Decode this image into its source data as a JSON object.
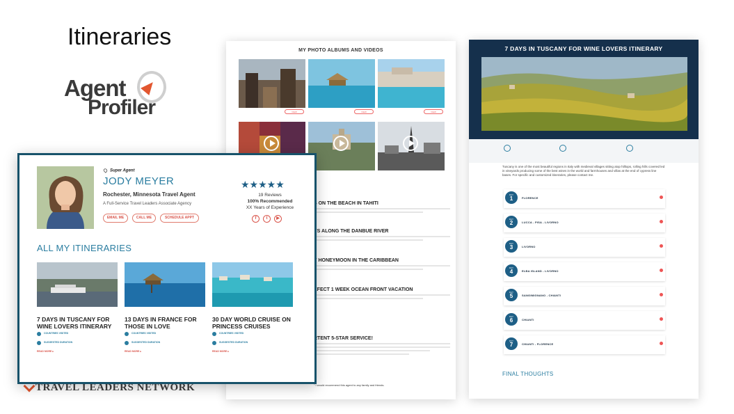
{
  "slide": {
    "title": "Itineraries",
    "logo_line1": "Agent",
    "logo_line2": "Profiler",
    "footer_brand": "TRAVEL LEADERS NETWORK"
  },
  "middle_doc": {
    "header": "MY PHOTO ALBUMS AND VIDEOS",
    "items": [
      "S ON THE BEACH IN TAHITI",
      "YS ALONG THE DANBUE RIVER",
      "Y HONEYMOON IN THE CARIBBEAN",
      "EFECT 1 WEEK OCEAN FRONT VACATION"
    ],
    "bottom_heading": "RTENT 5-STAR SERVICE!",
    "bottom_line": "\" I would recommend this agent to any family and friends."
  },
  "right_doc": {
    "title": "7 DAYS IN TUSCANY FOR WINE LOVERS ITINERARY",
    "intro": "Tuscany is one of the most beautiful regions in Italy with medieval villages sitting atop hilltops, rolling hills covered led in vineyards producing some of the best wines in the world and farmhouses and villas at the end of cypress line bases. For specific and customized itineraries, please contact me.",
    "days": [
      {
        "label": "DAY",
        "num": "1",
        "place": "FLORENCE"
      },
      {
        "label": "DAY",
        "num": "2",
        "place": "LUCCA - PISA - LIVORNO"
      },
      {
        "label": "DAY",
        "num": "3",
        "place": "LIVORNO"
      },
      {
        "label": "DAY",
        "num": "4",
        "place": "ELBA ISLAND - LIVORNO"
      },
      {
        "label": "DAY",
        "num": "5",
        "place": "SANGIMIGNANO - CHIANTI"
      },
      {
        "label": "DAY",
        "num": "6",
        "place": "CHIANTI"
      },
      {
        "label": "DAY",
        "num": "7",
        "place": "CHIANTI - FLORENCE"
      }
    ],
    "final": "FINAL THOUGHTS"
  },
  "profile": {
    "badge": "Super Agent",
    "name": "JODY MEYER",
    "role": "Rochester, Minnesota Travel Agent",
    "subtitle": "A Full-Service Travel Leaders Associate Agency",
    "buttons": [
      "EMAIL ME",
      "CALL ME",
      "SCHEDULE APPT"
    ],
    "stars": "★★★★★",
    "reviews": "19 Reviews",
    "recommended": "100% Recommended",
    "experience": "XX Years of Experience",
    "section_title": "ALL MY ITINERARIES",
    "itineraries": [
      {
        "title": "7 DAYS IN TUSCANY FOR WINE LOVERS ITINERARY",
        "countries_label": "COUNTRIES VISITED",
        "duration_label": "SUGGESTED DURATION",
        "read": "READ MORE ▸"
      },
      {
        "title": "13 DAYS IN FRANCE FOR THOSE IN LOVE",
        "countries_label": "COUNTRIES VISITED",
        "duration_label": "SUGGESTED DURATION",
        "read": "READ MORE ▸"
      },
      {
        "title": "30 DAY WORLD CRUISE ON PRINCESS CRUISES",
        "countries_label": "COUNTRIES VISITED",
        "duration_label": "SUGGESTED DURATION",
        "read": "READ MORE ▸"
      }
    ]
  },
  "icons": {
    "facebook": "f",
    "twitter": "t",
    "youtube": "▶"
  },
  "colors": {
    "accent": "#2a7da0",
    "navy": "#15304c",
    "card_border": "#17526a",
    "cta": "#d9544a"
  }
}
